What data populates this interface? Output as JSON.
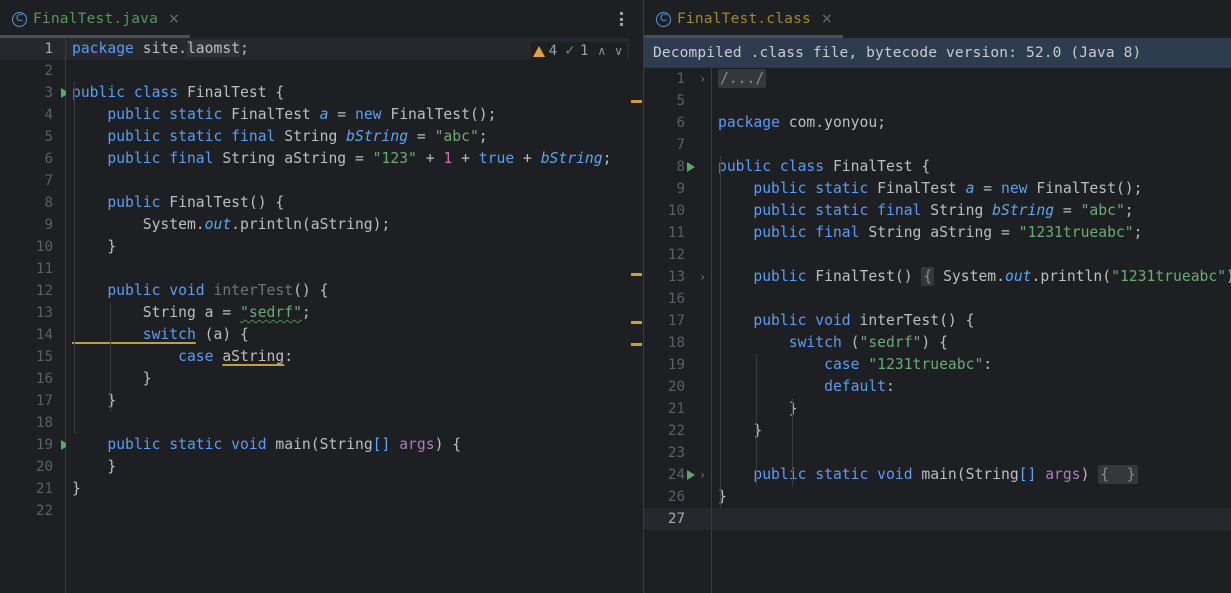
{
  "window": {
    "background": "#1e1f22",
    "accent_green": "#57965c",
    "accent_yellow": "#9e8b26",
    "warning_color": "#c9a227"
  },
  "left_editor": {
    "tab": {
      "label": "FinalTest.java",
      "icon": "java-class-icon",
      "icon_glyph": "C",
      "close_glyph": "×",
      "active": true
    },
    "kebab_menu": "more-options",
    "inspection": {
      "warning_icon": "warning-triangle-icon",
      "warning_count": "4",
      "ok_icon": "inspection-ok-icon",
      "ok_count": "1",
      "up_glyph": "∧",
      "down_glyph": "∨"
    },
    "current_line": 1,
    "lines": [
      {
        "n": "1",
        "run": false,
        "cur": true,
        "tokens": [
          {
            "t": "package ",
            "c": "kw"
          },
          {
            "t": "site.",
            "c": "plain"
          },
          {
            "t": "laomst",
            "c": "plain selbox"
          },
          {
            "t": ";",
            "c": "plain"
          }
        ]
      },
      {
        "n": "2",
        "run": false,
        "tokens": []
      },
      {
        "n": "3",
        "run": true,
        "tokens": [
          {
            "t": "public class ",
            "c": "kw"
          },
          {
            "t": "FinalTest",
            "c": "plain"
          },
          {
            "t": " {",
            "c": "plain"
          }
        ]
      },
      {
        "n": "4",
        "run": false,
        "tokens": [
          {
            "t": "    public static ",
            "c": "kw"
          },
          {
            "t": "FinalTest ",
            "c": "plain"
          },
          {
            "t": "a",
            "c": "fldi"
          },
          {
            "t": " = ",
            "c": "plain"
          },
          {
            "t": "new ",
            "c": "kw"
          },
          {
            "t": "FinalTest();",
            "c": "plain"
          }
        ]
      },
      {
        "n": "5",
        "run": false,
        "tokens": [
          {
            "t": "    public static final ",
            "c": "kw"
          },
          {
            "t": "String ",
            "c": "plain"
          },
          {
            "t": "bString",
            "c": "fldi"
          },
          {
            "t": " = ",
            "c": "plain"
          },
          {
            "t": "\"abc\"",
            "c": "str"
          },
          {
            "t": ";",
            "c": "plain"
          }
        ]
      },
      {
        "n": "6",
        "run": false,
        "tokens": [
          {
            "t": "    public final ",
            "c": "kw"
          },
          {
            "t": "String ",
            "c": "plain"
          },
          {
            "t": "aString",
            "c": "plain"
          },
          {
            "t": " = ",
            "c": "plain"
          },
          {
            "t": "\"123\"",
            "c": "str"
          },
          {
            "t": " + ",
            "c": "plain"
          },
          {
            "t": "1",
            "c": "num"
          },
          {
            "t": " + ",
            "c": "plain"
          },
          {
            "t": "true",
            "c": "kw"
          },
          {
            "t": " + ",
            "c": "plain"
          },
          {
            "t": "bString",
            "c": "fldi"
          },
          {
            "t": ";",
            "c": "plain"
          }
        ]
      },
      {
        "n": "7",
        "run": false,
        "tokens": []
      },
      {
        "n": "8",
        "run": false,
        "tokens": [
          {
            "t": "    public ",
            "c": "kw"
          },
          {
            "t": "FinalTest() {",
            "c": "plain"
          }
        ]
      },
      {
        "n": "9",
        "run": false,
        "tokens": [
          {
            "t": "        System.",
            "c": "plain"
          },
          {
            "t": "out",
            "c": "fldi"
          },
          {
            "t": ".println(aString);",
            "c": "plain"
          }
        ]
      },
      {
        "n": "10",
        "run": false,
        "tokens": [
          {
            "t": "    }",
            "c": "plain"
          }
        ]
      },
      {
        "n": "11",
        "run": false,
        "tokens": []
      },
      {
        "n": "12",
        "run": false,
        "tokens": [
          {
            "t": "    public void ",
            "c": "kw"
          },
          {
            "t": "interTest",
            "c": "grey"
          },
          {
            "t": "() {",
            "c": "plain"
          }
        ]
      },
      {
        "n": "13",
        "run": false,
        "tokens": [
          {
            "t": "        String a = ",
            "c": "plain"
          },
          {
            "t": "\"sedrf\"",
            "c": "str squiggle"
          },
          {
            "t": ";",
            "c": "plain"
          }
        ]
      },
      {
        "n": "14",
        "run": false,
        "tokens": [
          {
            "t": "        switch",
            "c": "kw warnunder"
          },
          {
            "t": " (a) {",
            "c": "plain"
          }
        ]
      },
      {
        "n": "15",
        "run": false,
        "tokens": [
          {
            "t": "            case ",
            "c": "kw"
          },
          {
            "t": "aString",
            "c": "plain warnunder"
          },
          {
            "t": ":",
            "c": "plain"
          }
        ]
      },
      {
        "n": "16",
        "run": false,
        "tokens": [
          {
            "t": "        }",
            "c": "plain"
          }
        ]
      },
      {
        "n": "17",
        "run": false,
        "tokens": [
          {
            "t": "    }",
            "c": "plain"
          }
        ]
      },
      {
        "n": "18",
        "run": false,
        "tokens": []
      },
      {
        "n": "19",
        "run": true,
        "tokens": [
          {
            "t": "    public static void ",
            "c": "kw"
          },
          {
            "t": "main",
            "c": "mcall"
          },
          {
            "t": "(",
            "c": "plain"
          },
          {
            "t": "String",
            "c": "plain"
          },
          {
            "t": "[]",
            "c": "methg"
          },
          {
            "t": " ",
            "c": "plain"
          },
          {
            "t": "args",
            "c": "param"
          },
          {
            "t": ") {",
            "c": "plain"
          }
        ]
      },
      {
        "n": "20",
        "run": false,
        "tokens": [
          {
            "t": "    }",
            "c": "plain"
          }
        ]
      },
      {
        "n": "21",
        "run": false,
        "tokens": [
          {
            "t": "}",
            "c": "plain"
          }
        ]
      },
      {
        "n": "22",
        "run": false,
        "tokens": []
      }
    ],
    "stripe_marks": [
      130,
      303,
      351,
      373
    ]
  },
  "right_editor": {
    "tab": {
      "label": "FinalTest.class",
      "icon": "java-class-icon",
      "icon_glyph": "C",
      "close_glyph": "×",
      "active": true
    },
    "banner": "Decompiled .class file, bytecode version: 52.0 (Java 8)",
    "current_line": 27,
    "lines": [
      {
        "n": "1",
        "fold": "›",
        "tokens": [
          {
            "t": "/.../",
            "c": "foldbox"
          }
        ]
      },
      {
        "n": "5",
        "tokens": []
      },
      {
        "n": "6",
        "tokens": [
          {
            "t": "package ",
            "c": "kw"
          },
          {
            "t": "com.yonyou;",
            "c": "plain"
          }
        ]
      },
      {
        "n": "7",
        "tokens": []
      },
      {
        "n": "8",
        "run": true,
        "tokens": [
          {
            "t": "public class ",
            "c": "kw"
          },
          {
            "t": "FinalTest",
            "c": "plain"
          },
          {
            "t": " {",
            "c": "plain"
          }
        ]
      },
      {
        "n": "9",
        "tokens": [
          {
            "t": "    public static ",
            "c": "kw"
          },
          {
            "t": "FinalTest ",
            "c": "plain"
          },
          {
            "t": "a",
            "c": "fldi"
          },
          {
            "t": " = ",
            "c": "plain"
          },
          {
            "t": "new ",
            "c": "kw"
          },
          {
            "t": "FinalTest();",
            "c": "plain"
          }
        ]
      },
      {
        "n": "10",
        "tokens": [
          {
            "t": "    public static final ",
            "c": "kw"
          },
          {
            "t": "String ",
            "c": "plain"
          },
          {
            "t": "bString",
            "c": "fldi"
          },
          {
            "t": " = ",
            "c": "plain"
          },
          {
            "t": "\"abc\"",
            "c": "str"
          },
          {
            "t": ";",
            "c": "plain"
          }
        ]
      },
      {
        "n": "11",
        "tokens": [
          {
            "t": "    public final ",
            "c": "kw"
          },
          {
            "t": "String ",
            "c": "plain"
          },
          {
            "t": "aString",
            "c": "plain"
          },
          {
            "t": " = ",
            "c": "plain"
          },
          {
            "t": "\"1231trueabc\"",
            "c": "str"
          },
          {
            "t": ";",
            "c": "plain"
          }
        ]
      },
      {
        "n": "12",
        "tokens": []
      },
      {
        "n": "13",
        "fold": "›",
        "tokens": [
          {
            "t": "    public ",
            "c": "kw"
          },
          {
            "t": "FinalTest() ",
            "c": "plain"
          },
          {
            "t": "{",
            "c": "foldbox"
          },
          {
            "t": " System.",
            "c": "plain"
          },
          {
            "t": "out",
            "c": "fldi"
          },
          {
            "t": ".println(",
            "c": "plain"
          },
          {
            "t": "\"1231trueabc\"",
            "c": "str"
          },
          {
            "t": "); ",
            "c": "plain"
          },
          {
            "t": "}",
            "c": "foldbox"
          }
        ]
      },
      {
        "n": "16",
        "tokens": []
      },
      {
        "n": "17",
        "tokens": [
          {
            "t": "    public void ",
            "c": "kw"
          },
          {
            "t": "interTest() {",
            "c": "plain"
          }
        ]
      },
      {
        "n": "18",
        "tokens": [
          {
            "t": "        switch ",
            "c": "kw"
          },
          {
            "t": "(",
            "c": "plain"
          },
          {
            "t": "\"sedrf\"",
            "c": "str"
          },
          {
            "t": ") {",
            "c": "plain"
          }
        ]
      },
      {
        "n": "19",
        "tokens": [
          {
            "t": "            case ",
            "c": "kw"
          },
          {
            "t": "\"1231trueabc\"",
            "c": "str"
          },
          {
            "t": ":",
            "c": "plain"
          }
        ]
      },
      {
        "n": "20",
        "tokens": [
          {
            "t": "            default",
            "c": "kw"
          },
          {
            "t": ":",
            "c": "plain"
          }
        ]
      },
      {
        "n": "21",
        "tokens": [
          {
            "t": "        }",
            "c": "plain"
          }
        ]
      },
      {
        "n": "22",
        "tokens": [
          {
            "t": "    }",
            "c": "plain"
          }
        ]
      },
      {
        "n": "23",
        "tokens": []
      },
      {
        "n": "24",
        "run": true,
        "fold": "›",
        "tokens": [
          {
            "t": "    public static void ",
            "c": "kw"
          },
          {
            "t": "main",
            "c": "mcall"
          },
          {
            "t": "(",
            "c": "plain"
          },
          {
            "t": "String",
            "c": "plain"
          },
          {
            "t": "[]",
            "c": "methg"
          },
          {
            "t": " ",
            "c": "plain"
          },
          {
            "t": "args",
            "c": "param"
          },
          {
            "t": ") ",
            "c": "plain"
          },
          {
            "t": "{  }",
            "c": "foldbox"
          }
        ]
      },
      {
        "n": "26",
        "tokens": [
          {
            "t": "}",
            "c": "plain"
          }
        ]
      },
      {
        "n": "27",
        "cur": true,
        "tokens": []
      }
    ]
  }
}
